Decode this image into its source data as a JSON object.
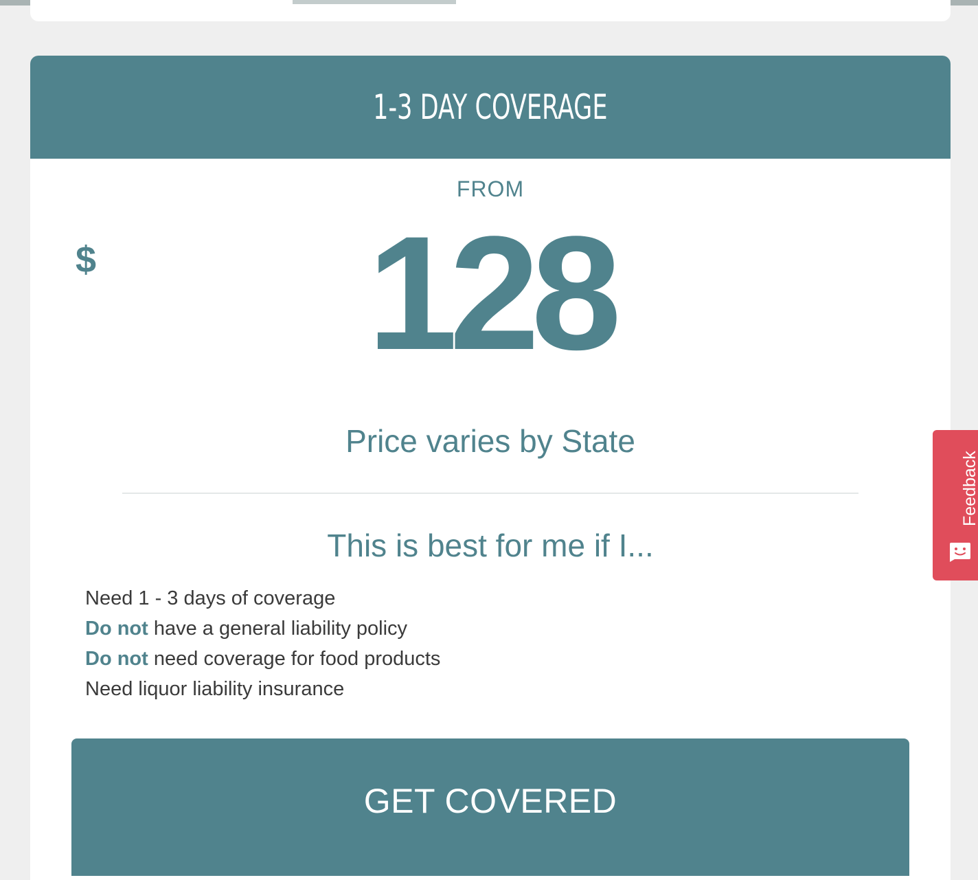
{
  "plan": {
    "title": "1-3 DAY COVERAGE",
    "from_label": "FROM",
    "currency": "$",
    "price": "128",
    "price_note": "Price varies by State"
  },
  "suitability": {
    "heading": "This is best for me if I...",
    "items": [
      {
        "emphasis": "",
        "text": "Need 1 - 3 days of coverage"
      },
      {
        "emphasis": "Do not",
        "text": " have a general liability policy"
      },
      {
        "emphasis": "Do not",
        "text": " need coverage for food products"
      },
      {
        "emphasis": "",
        "text": "Need liquor liability insurance"
      }
    ]
  },
  "cta": {
    "label": "GET COVERED"
  },
  "feedback": {
    "label": "Feedback",
    "icon": "smiley-chat-icon"
  },
  "colors": {
    "accent": "#50838d",
    "feedback": "#e04d5b",
    "background": "#efefef"
  }
}
